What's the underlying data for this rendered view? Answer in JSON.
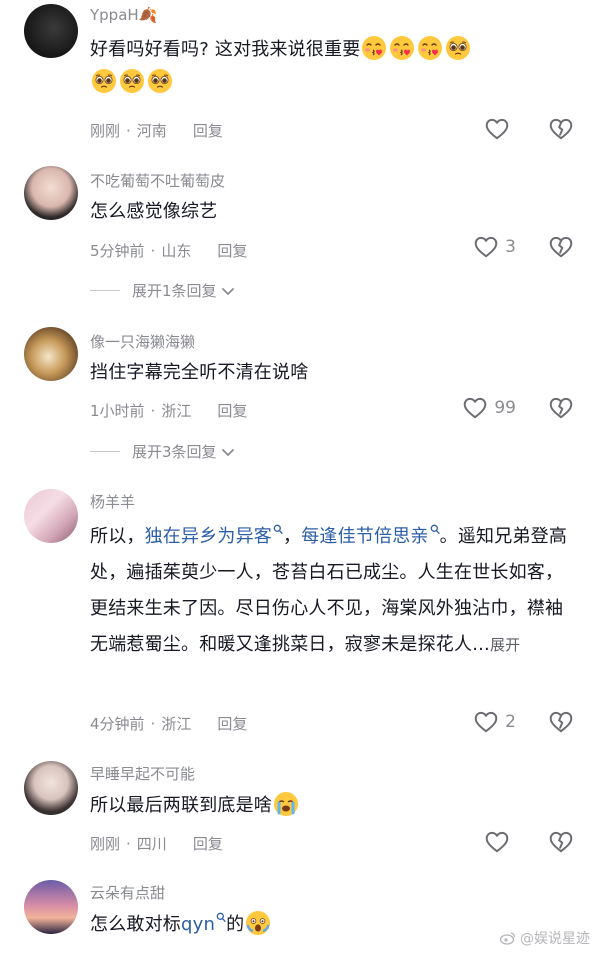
{
  "comments": [
    {
      "username": "YppaH🍂",
      "text": "好看吗好看吗? 这对我来说很重要",
      "time": "刚刚",
      "location": "河南",
      "reply": "回复",
      "likes": ""
    },
    {
      "username": "不吃葡萄不吐葡萄皮",
      "text": "怎么感觉像综艺",
      "time": "5分钟前",
      "location": "山东",
      "reply": "回复",
      "likes": "3",
      "expand": "展开1条回复"
    },
    {
      "username": "像一只海獭海獭",
      "text": "挡住字幕完全听不清在说啥",
      "time": "1小时前",
      "location": "浙江",
      "reply": "回复",
      "likes": "99",
      "expand": "展开3条回复"
    },
    {
      "username": "杨羊羊",
      "text_prefix": "所以，",
      "link1": "独在异乡为异客",
      "link_sep": "，",
      "link2": "每逢佳节倍思亲",
      "text_rest": "。遥知兄弟登高处，遍插茱萸少一人，苍苔白石已成尘。人生在世长如客，更结来生未了因。尽日伤心人不见，海棠风外独沾巾，襟袖无端惹蜀尘。和暖又逢挑菜日，寂寥未是探花人...",
      "more": "展开",
      "time": "4分钟前",
      "location": "浙江",
      "reply": "回复",
      "likes": "2"
    },
    {
      "username": "早睡早起不可能",
      "text": "所以最后两联到底是啥",
      "time": "刚刚",
      "location": "四川",
      "reply": "回复",
      "likes": ""
    },
    {
      "username": "云朵有点甜",
      "text_prefix": "怎么敢对标",
      "link1": "qyn",
      "text_rest": "的"
    }
  ],
  "watermark": "@娱说星迹",
  "icons": {
    "like": "heart-outline-icon",
    "dislike": "broken-heart-icon",
    "expand": "chevron-down-icon",
    "search": "search-icon"
  }
}
